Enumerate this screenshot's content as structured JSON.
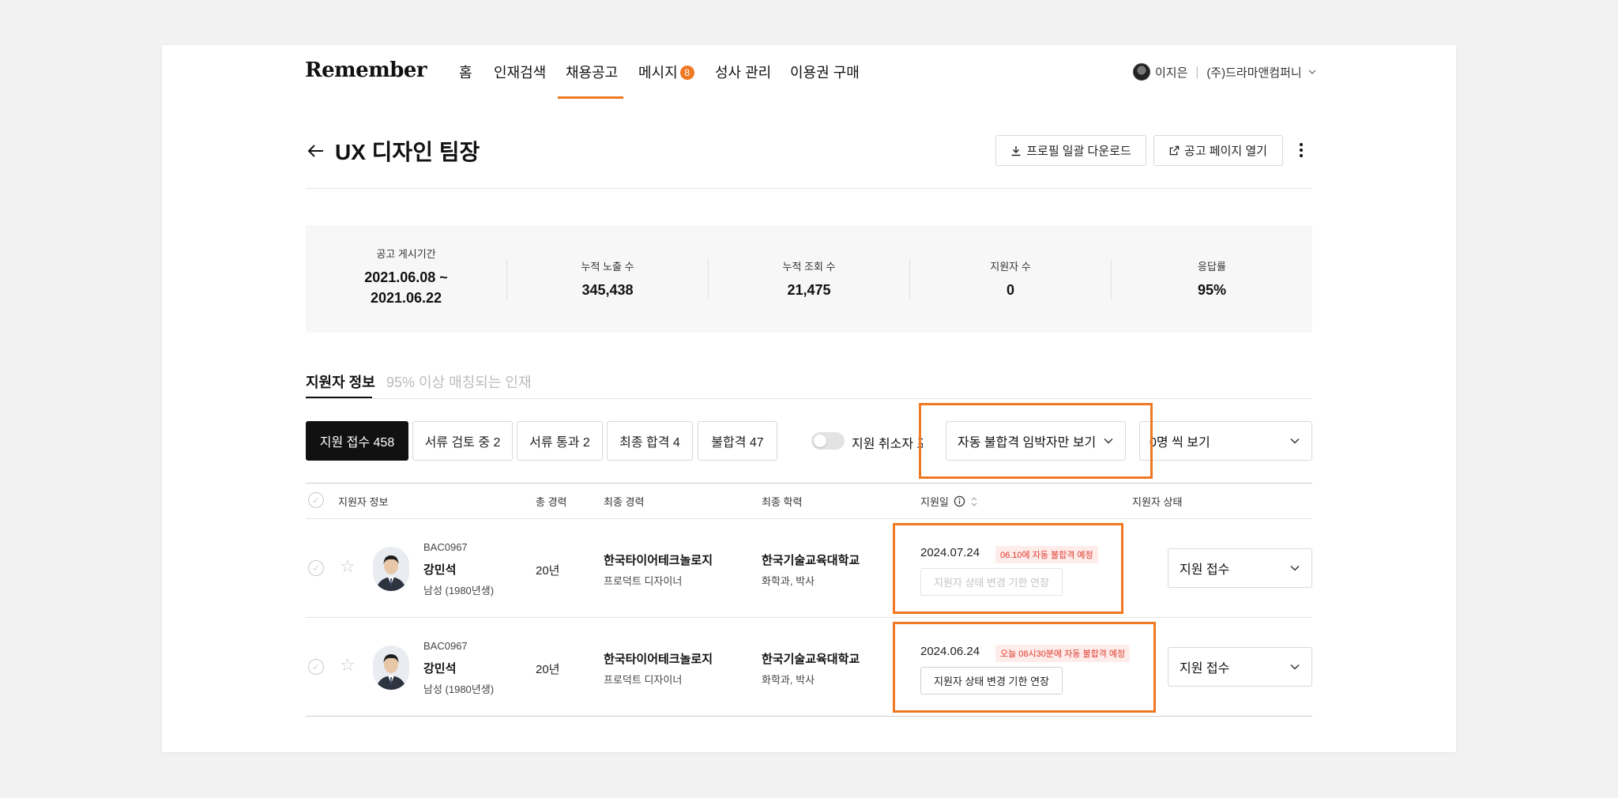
{
  "header": {
    "logo": "Remember",
    "nav": [
      "홈",
      "인재검색",
      "채용공고",
      "메시지",
      "성사 관리",
      "이용권 구매"
    ],
    "message_badge": "8",
    "user_name": "이지은",
    "company": "(주)드라마앤컴퍼니"
  },
  "page": {
    "title": "UX 디자인 팀장",
    "download_label": "프로필 일괄 다운로드",
    "open_label": "공고 페이지 열기"
  },
  "stats": {
    "period_label": "공고 게시기간",
    "period_start": "2021.06.08 ~",
    "period_end": "2021.06.22",
    "impressions_label": "누적 노출 수",
    "impressions": "345,438",
    "views_label": "누적 조회 수",
    "views": "21,475",
    "applicants_label": "지원자 수",
    "applicants": "0",
    "response_label": "응답률",
    "response": "95%"
  },
  "tabs": [
    "지원자 정보",
    "95% 이상 매칭되는 인재"
  ],
  "filters": [
    "지원 접수 458",
    "서류 검토 중 2",
    "서류 통과 2",
    "최종 합격 4",
    "불합격 47"
  ],
  "toggle_label": "지원 취소자 포",
  "auto_reject_select": "자동 불합격 임박자만 보기",
  "page_size_select": "0명 씩 보기",
  "table": {
    "headers": [
      "지원자 정보",
      "총 경력",
      "최종 경력",
      "최종 학력",
      "지원일",
      "지원자 상태"
    ],
    "rows": [
      {
        "code": "BAC0967",
        "name": "강민석",
        "gender": "남성 (1980년생)",
        "years": "20년",
        "company": "한국타이어테크놀로지",
        "role": "프로덕트 디자이너",
        "school": "한국기술교육대학교",
        "major": "화학과, 박사",
        "date": "2024.07.24",
        "tag": "06.10에 자동 불합격 예정",
        "extend": "지원자 상태 변경 기한 연장",
        "status": "지원 접수"
      },
      {
        "code": "BAC0967",
        "name": "강민석",
        "gender": "남성 (1980년생)",
        "years": "20년",
        "company": "한국타이어테크놀로지",
        "role": "프로덕트 디자이너",
        "school": "한국기술교육대학교",
        "major": "화학과, 박사",
        "date": "2024.06.24",
        "tag": "오늘 08시30분에 자동 불합격 예정",
        "extend": "지원자 상태 변경 기한 연장",
        "status": "지원 접수"
      }
    ]
  },
  "colors": {
    "accent": "#f07822",
    "warning_text": "#e03a2e",
    "warning_bg": "#fdecea"
  }
}
